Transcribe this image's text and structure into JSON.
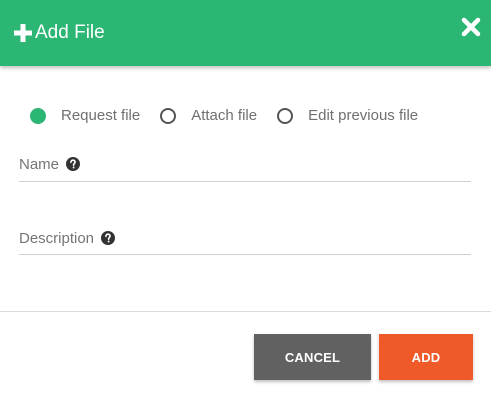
{
  "header": {
    "title": "Add File",
    "plus_icon": "plus-icon",
    "close_icon": "close-icon",
    "background_color": "#2bb673"
  },
  "file_source": {
    "selected": "Request file",
    "options": [
      {
        "label": "Request file",
        "selected": true
      },
      {
        "label": "Attach file",
        "selected": false
      },
      {
        "label": "Edit previous file",
        "selected": false
      }
    ]
  },
  "fields": {
    "name": {
      "label": "Name",
      "value": "",
      "help_icon": "question-circle-icon"
    },
    "description": {
      "label": "Description",
      "value": "",
      "help_icon": "question-circle-icon"
    }
  },
  "actions": {
    "cancel_label": "CANCEL",
    "add_label": "ADD",
    "cancel_color": "#616161",
    "add_color": "#f05a28"
  }
}
